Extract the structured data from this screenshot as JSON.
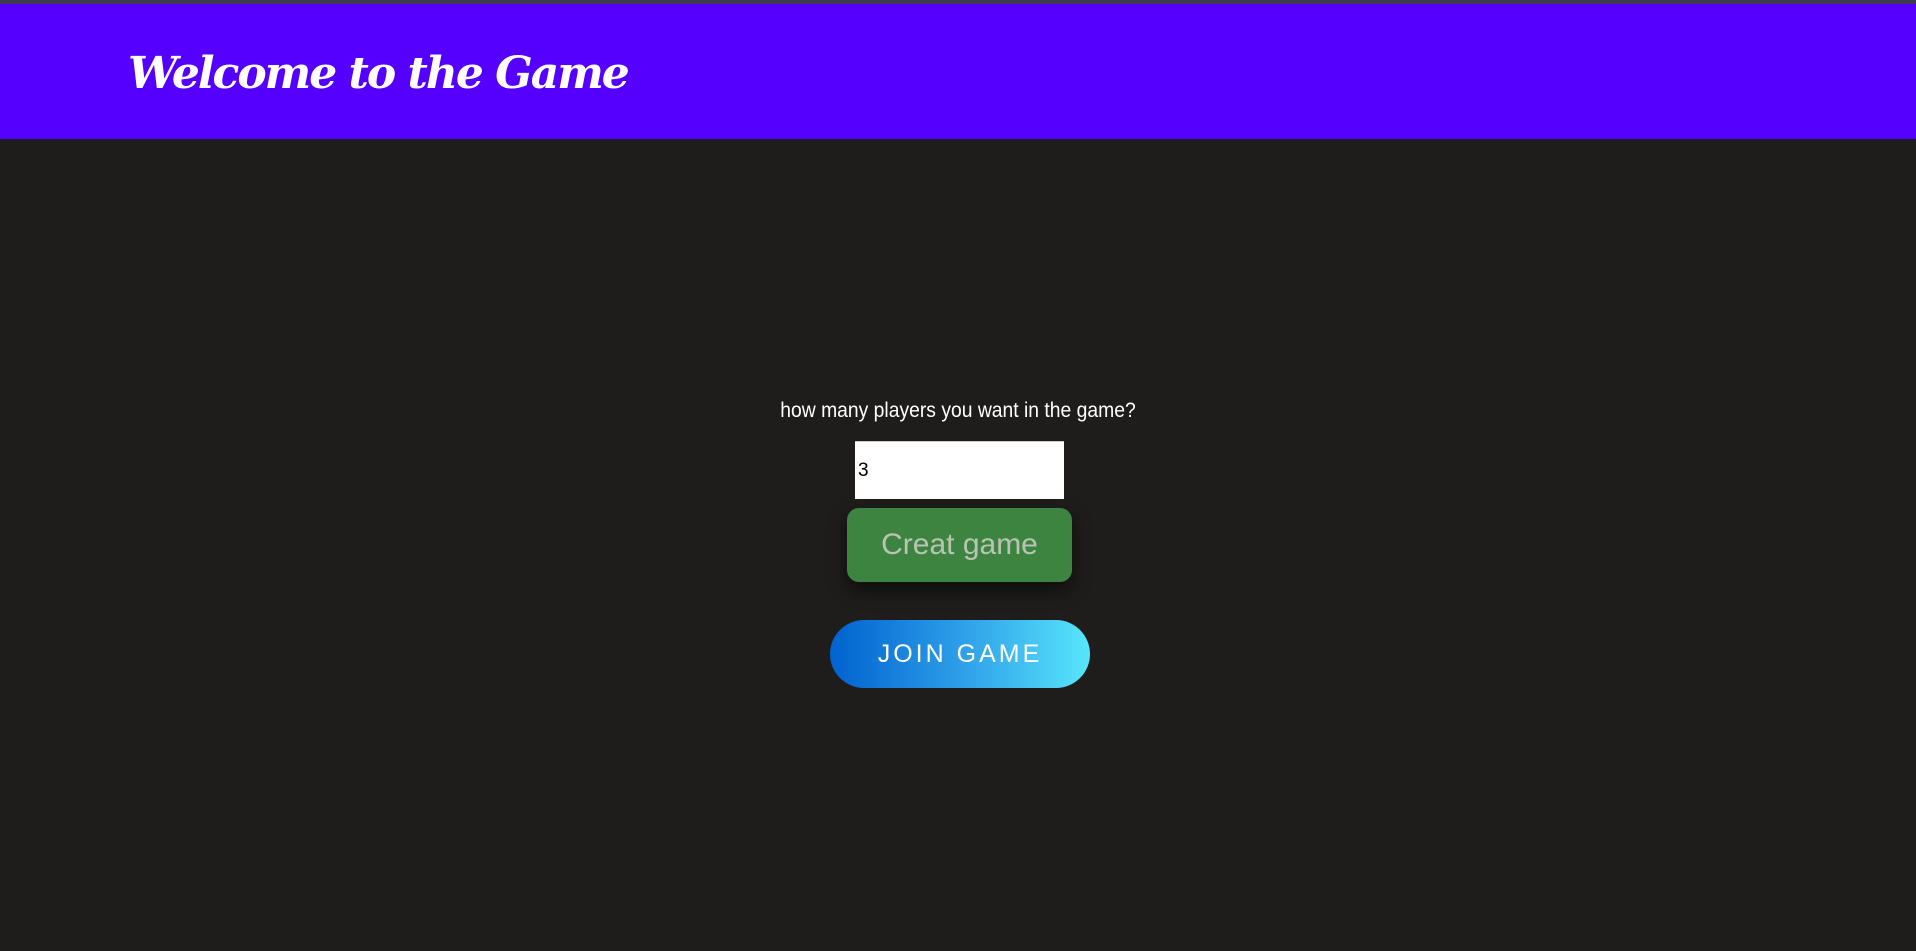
{
  "header": {
    "title": "Welcome to the Game",
    "background_color": "#5500ff"
  },
  "main": {
    "background_color": "#1e1d1c",
    "prompt": "how many players you want in the game?",
    "players_input": {
      "value": "3",
      "placeholder": ""
    },
    "create_button": {
      "label": "Creat game",
      "color": "#3d8440"
    },
    "join_button": {
      "label": "JOIN GAME",
      "gradient": [
        "#0062cf",
        "#58e6fb"
      ]
    }
  }
}
